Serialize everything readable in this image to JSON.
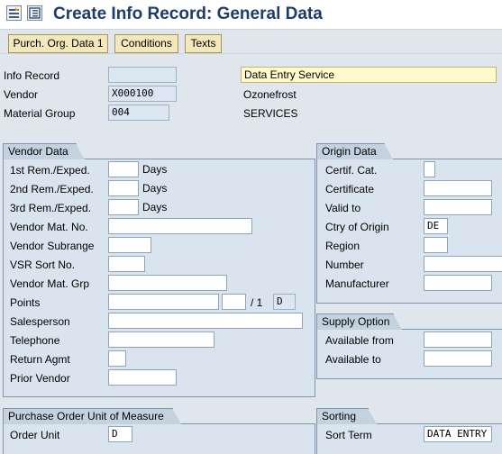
{
  "window": {
    "title": "Create Info Record: General Data"
  },
  "toolbar": {
    "purch_org": "Purch. Org. Data 1",
    "conditions": "Conditions",
    "texts": "Texts"
  },
  "header": {
    "info_record": {
      "label": "Info Record",
      "value": ""
    },
    "vendor": {
      "label": "Vendor",
      "value": "X000100",
      "desc": "Ozonefrost"
    },
    "material_group": {
      "label": "Material Group",
      "value": "004",
      "desc": "SERVICES"
    },
    "short_text": "Data Entry Service"
  },
  "vendor_data": {
    "title": "Vendor Data",
    "days_unit": "Days",
    "rem1": {
      "label": "1st Rem./Exped.",
      "value": ""
    },
    "rem2": {
      "label": "2nd Rem./Exped.",
      "value": ""
    },
    "rem3": {
      "label": "3rd Rem./Exped.",
      "value": ""
    },
    "vendor_mat_no": {
      "label": "Vendor Mat. No.",
      "value": ""
    },
    "vendor_subrange": {
      "label": "Vendor Subrange",
      "value": ""
    },
    "vsr_sort_no": {
      "label": "VSR Sort No.",
      "value": ""
    },
    "vendor_mat_grp": {
      "label": "Vendor Mat. Grp",
      "value": ""
    },
    "points": {
      "label": "Points",
      "value": "",
      "unit": "",
      "separator": "/ 1",
      "per_unit": "D"
    },
    "salesperson": {
      "label": "Salesperson",
      "value": ""
    },
    "telephone": {
      "label": "Telephone",
      "value": ""
    },
    "return_agmt": {
      "label": "Return Agmt",
      "value": ""
    },
    "prior_vendor": {
      "label": "Prior Vendor",
      "value": ""
    }
  },
  "origin_data": {
    "title": "Origin Data",
    "certif_cat": {
      "label": "Certif. Cat.",
      "value": ""
    },
    "certificate": {
      "label": "Certificate",
      "value": ""
    },
    "valid_to": {
      "label": "Valid to",
      "value": ""
    },
    "ctry_of_origin": {
      "label": "Ctry of Origin",
      "value": "DE"
    },
    "region": {
      "label": "Region",
      "value": ""
    },
    "number": {
      "label": "Number",
      "value": ""
    },
    "manufacturer": {
      "label": "Manufacturer",
      "value": ""
    }
  },
  "supply_option": {
    "title": "Supply Option",
    "available_from": {
      "label": "Available from",
      "value": ""
    },
    "available_to": {
      "label": "Available to",
      "value": ""
    }
  },
  "po_unit": {
    "title": "Purchase Order Unit of Measure",
    "order_unit": {
      "label": "Order Unit",
      "value": "D"
    }
  },
  "sorting": {
    "title": "Sorting",
    "sort_term": {
      "label": "Sort Term",
      "value": "DATA ENTRY"
    }
  },
  "icons": {
    "menu": "menu-icon",
    "layout": "layout-icon"
  }
}
